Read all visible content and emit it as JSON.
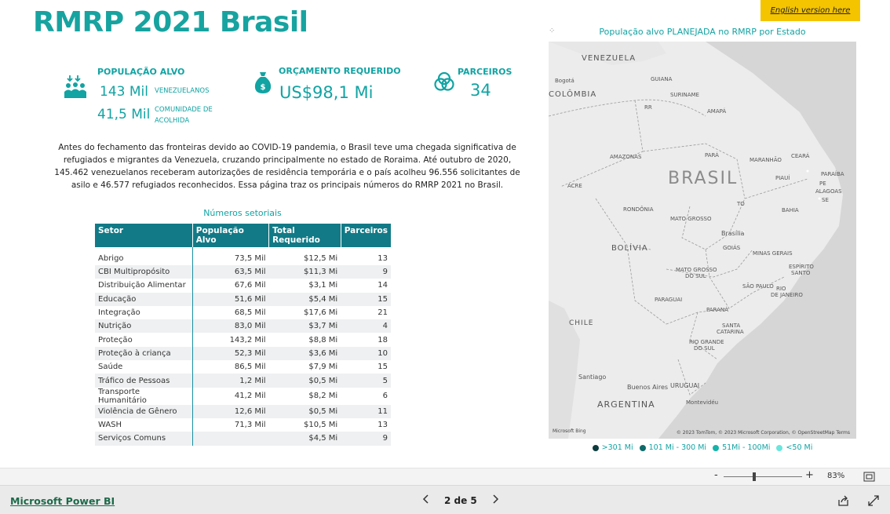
{
  "report": {
    "title": "RMRP 2021 Brasil",
    "english_link": "English version here"
  },
  "kpis": {
    "populacao": {
      "heading": "POPULAÇÃO ALVO",
      "venezuelanos_value": "143 Mil",
      "venezuelanos_label": "VENEZUELANOS",
      "comunidade_value": "41,5 Mil",
      "comunidade_label_1": "COMUNIDADE DE",
      "comunidade_label_2": "ACOLHIDA"
    },
    "orcamento": {
      "heading": "ORÇAMENTO REQUERIDO",
      "value": "US$98,1 Mi"
    },
    "parceiros": {
      "heading": "PARCEIROS",
      "value": "34"
    }
  },
  "intro_text": "Antes do fechamento das fronteiras devido ao COVID-19 pandemia, o Brasil teve uma chegada significativa de refugiados e migrantes da Venezuela, cruzando principalmente no estado de Roraima. Até outubro de 2020, 145.462 venezuelanos receberam autorizações de residência temporária e o país acolheu 96.556 solicitantes de asilo e 46.577 refugiados reconhecidos. Essa página traz os principais números do RMRP 2021 no Brasil.",
  "table": {
    "title": "Números setoriais",
    "headers": [
      "Setor",
      "População Alvo",
      "Total Requerido",
      "Parceiros"
    ],
    "rows": [
      [
        "Abrigo",
        "73,5 Mil",
        "$12,5 Mi",
        "13"
      ],
      [
        "CBI Multipropósito",
        "63,5 Mil",
        "$11,3 Mi",
        "9"
      ],
      [
        "Distribuição Alimentar",
        "67,6 Mil",
        "$3,1 Mi",
        "14"
      ],
      [
        "Educação",
        "51,6 Mil",
        "$5,4 Mi",
        "15"
      ],
      [
        "Integração",
        "68,5 Mil",
        "$17,6 Mi",
        "21"
      ],
      [
        "Nutrição",
        "83,0 Mil",
        "$3,7 Mi",
        "4"
      ],
      [
        "Proteção",
        "143,2 Mil",
        "$8,8 Mi",
        "18"
      ],
      [
        "Proteção à criança",
        "52,3 Mil",
        "$3,6 Mi",
        "10"
      ],
      [
        "Saúde",
        "86,5 Mil",
        "$7,9 Mi",
        "15"
      ],
      [
        "Tráfico de Pessoas",
        "1,2 Mil",
        "$0,5 Mi",
        "5"
      ],
      [
        "Transporte Humanitário",
        "41,2 Mil",
        "$8,2 Mi",
        "6"
      ],
      [
        "Violência de Gênero",
        "12,6 Mil",
        "$0,5 Mi",
        "11"
      ],
      [
        "WASH",
        "71,3 Mil",
        "$10,5 Mi",
        "13"
      ],
      [
        "Serviços Comuns",
        "",
        "$4,5 Mi",
        "9"
      ]
    ]
  },
  "map": {
    "title": "População alvo PLANEJADA no RMRP por Estado",
    "labels": {
      "venezuela": "VENEZUELA",
      "guiana": "GUIANA",
      "suriname": "SURINAME",
      "colombia": "COLÔMBIA",
      "bogota": "Bogotá",
      "rr": "RR",
      "amapa": "AMAPÁ",
      "amazonas": "AMAZONAS",
      "para": "PARÁ",
      "maranhao": "MARANHÃO",
      "ceara": "CEARÁ",
      "paraiba": "PARAÍBA",
      "piaui": "PIAUÍ",
      "pe": "PE",
      "alagoas": "ALAGOAS",
      "se": "SE",
      "acre": "ACRE",
      "brasil": "BRASIL",
      "rondonia": "RONDÔNIA",
      "to": "TO",
      "bahia": "BAHIA",
      "mato_grosso": "MATO GROSSO",
      "brasilia": "Brasília",
      "bolivia": "BOLÍVIA",
      "goias": "GOIÁS",
      "minas": "MINAS GERAIS",
      "ms_1": "MATO GROSSO",
      "ms_2": "DO SUL",
      "es_1": "ESPÍRITO",
      "es_2": "SANTO",
      "sao_paulo": "SÃO PAULO",
      "rj_1": "RIO",
      "rj_2": "DE JANEIRO",
      "paraguai": "PARAGUAI",
      "parana": "PARANÁ",
      "chile": "CHILE",
      "sc_1": "SANTA",
      "sc_2": "CATARINA",
      "rs_1": "RIO GRANDE",
      "rs_2": "DO SUL",
      "santiago": "Santiago",
      "buenos_aires": "Buenos Aires",
      "uruguai": "URUGUAI",
      "argentina": "ARGENTINA",
      "montevideu": "Montevidéu"
    },
    "credit": "© 2023 TomTom, © 2023 Microsoft Corporation, © OpenStreetMap  Terms",
    "logo": "Microsoft Bing"
  },
  "legend": [
    {
      "label": ">301 Mi",
      "color": "#0b3b3d"
    },
    {
      "label": "101 Mi - 300 Mi",
      "color": "#0e6a6b"
    },
    {
      "label": "51Mi - 100Mi",
      "color": "#15b3aa"
    },
    {
      "label": "<50 Mi",
      "color": "#6ae6dd"
    }
  ],
  "zoom": {
    "minus": "-",
    "plus": "+",
    "level": "83%",
    "level_pct": 83
  },
  "footer": {
    "brand": "Microsoft Power BI",
    "page_indicator": "2 de 5"
  },
  "colors": {
    "accent": "#12a3a3",
    "header": "#127a86",
    "button": "#f5c400"
  }
}
